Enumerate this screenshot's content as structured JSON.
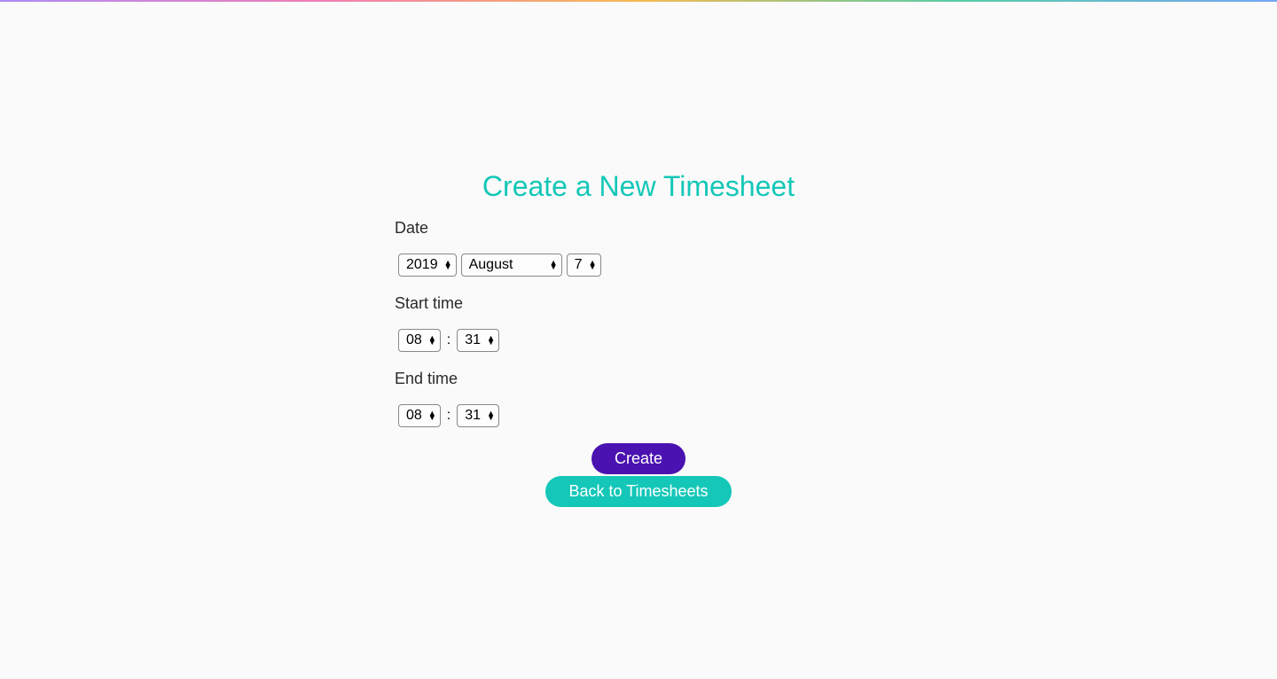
{
  "page": {
    "title": "Create a New Timesheet"
  },
  "form": {
    "date_label": "Date",
    "date": {
      "year": "2019",
      "month": "August",
      "day": "7"
    },
    "start_time_label": "Start time",
    "start_time": {
      "hour": "08",
      "minute": "31"
    },
    "end_time_label": "End time",
    "end_time": {
      "hour": "08",
      "minute": "31"
    },
    "time_separator": ":"
  },
  "buttons": {
    "create": "Create",
    "back": "Back to Timesheets"
  },
  "colors": {
    "accent_teal": "#14c7b8",
    "accent_purple": "#4a12b0"
  }
}
